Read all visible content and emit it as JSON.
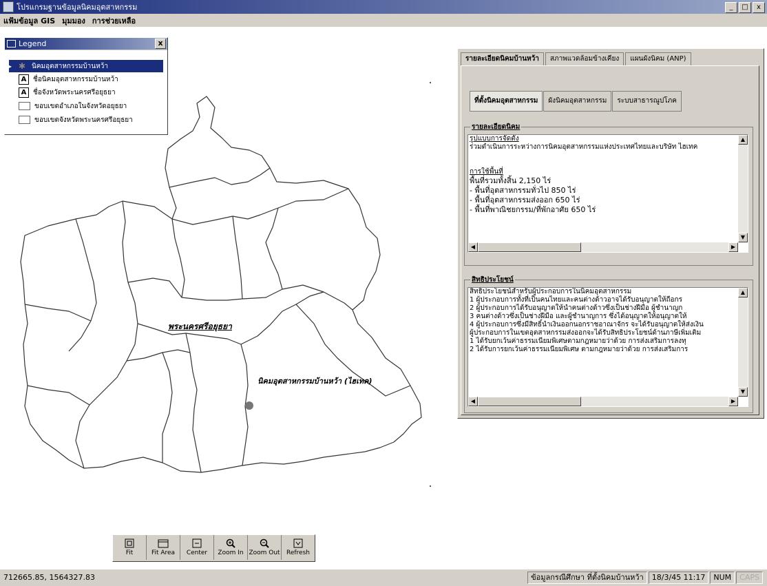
{
  "window": {
    "title": "โปรแกรมฐานข้อมูลนิคมอุตสาหกรรม",
    "buttons": [
      "_",
      "□",
      "x"
    ]
  },
  "menubar": {
    "items": [
      "แฟ้มข้อมูล GIS",
      "มุมมอง",
      "การช่วยเหลือ"
    ]
  },
  "legend": {
    "title": "Legend",
    "close_label": "x",
    "items": [
      {
        "symbol": "star-icon",
        "label": "นิคมอุตสาหกรรมบ้านหว้า"
      },
      {
        "symbol": "label-a-icon",
        "label": "ชื่อนิคมอุตสาหกรรมบ้านหว้า"
      },
      {
        "symbol": "label-a-icon",
        "label": "ชื่อจังหวัดพระนครศรีอยุธยา"
      },
      {
        "symbol": "box-icon",
        "label": "ขอบเขตอำเภอในจังหวัดอยุธยา"
      },
      {
        "symbol": "box-icon",
        "label": "ขอบเขตจังหวัดพระนครศรีอยุธยา"
      }
    ]
  },
  "map": {
    "province_label": "พระนครศรีอยุธยา",
    "estate_label": "นิคมอุตสาหกรรมบ้านหว้า (ไฮเทค)"
  },
  "panel": {
    "tabs": [
      "รายละเอียดนิคมบ้านหว้า",
      "สภาพแวดล้อมข้างเคียง",
      "แผนผังนิคม (ANP)"
    ],
    "subtabs": [
      "ที่ตั้งนิคมอุตสาหกรรม",
      "ผังนิคมอุตสาหกรรม",
      "ระบบสาธารณูปโภค"
    ],
    "details": {
      "label": "รายละเอียดนิคม",
      "lines": [
        "รูปแบบการจัดตั้ง",
        "ร่วมดำเนินการระหว่างการนิคมอุตสาหกรรมแห่งประเทศไทยและบริษัท ไฮเทค",
        "",
        "การใช้พื้นที่",
        "พื้นที่รวมทั้งสิ้น 2,150 ไร่",
        " - พื้นที่อุตสาหกรรมทั่วไป 850 ไร่",
        " - พื้นที่อุตสาหกรรมส่งออก 650 ไร่",
        " - พื้นที่พาณิชยกรรม/ที่พักอาศัย 650 ไร่"
      ]
    },
    "benefits": {
      "label": "สิทธิประโยชน์",
      "lines": [
        "สิทธิประโยชน์สำหรับผู้ประกอบการในนิคมอุตสาหกรรม",
        "     1  ผู้ประกอบการทั้งที่เป็นคนไทยและคนต่างด้าวอาจได้รับอนุญาตให้ถือกร",
        "     2  ผู้ประกอบการได้รับอนุญาตให้นำคนต่างด้าวซึ่งเป็นช่างฝีมือ ผู้ชำนาญก",
        "     3  คนต่างด้าวซึ่งเป็นช่างฝีมือ และผู้ชำนาญการ ซึ่งได้อนุญาตให้อนุญาตให้",
        "     4  ผู้ประกอบการซึ่งมีสิทธิ์นำเงินออกนอกราชอาณาจักร จะได้รับอนุญาตให้ส่งเงิน",
        "ผู้ประกอบการในเขตอุตสาหกรรมส่งออกจะได้รับสิทธิประโยชน์ด้านภาษีเพิ่มเติม",
        "      1 ได้รับยกเว้นค่าธรรมเนียมพิเศษตามกฎหมายว่าด้วย การส่งเสริมการลงทุ",
        "      2 ได้รับการยกเว้นค่าธรรมเนียมพิเศษ ตามกฎหมายว่าด้วย การส่งเสริมการ"
      ]
    }
  },
  "toolbar": {
    "buttons": [
      {
        "icon": "fit-icon",
        "label": "Fit"
      },
      {
        "icon": "fit-area-icon",
        "label": "Fit Area"
      },
      {
        "icon": "center-icon",
        "label": "Center"
      },
      {
        "icon": "zoom-in-icon",
        "label": "Zoom In"
      },
      {
        "icon": "zoom-out-icon",
        "label": "Zoom Out"
      },
      {
        "icon": "refresh-icon",
        "label": "Refresh"
      }
    ]
  },
  "statusbar": {
    "coords": "712665.85, 1564327.83",
    "message": "ข้อมูลกรณีศึกษา ที่ตั้งนิคมบ้านหว้า",
    "datetime": "18/3/45  11:17",
    "num": "NUM",
    "caps": "CAPS"
  }
}
